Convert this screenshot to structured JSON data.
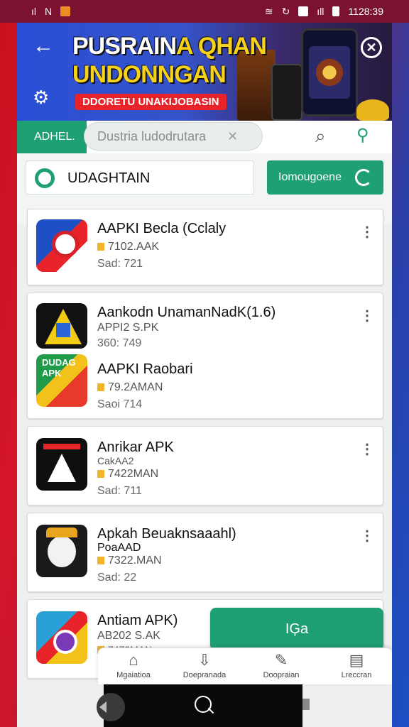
{
  "status": {
    "time": "1128:39"
  },
  "banner": {
    "title_line1_white": "PUSRAIN",
    "title_line1_yellow": "A QHAN",
    "title_line2": "UNDONNGAN",
    "tagline": "DDORETU UNAKIJOBASIN"
  },
  "search": {
    "label": "ADHEL.",
    "placeholder": "Dustria ludodrutara",
    "clear_label": "✕"
  },
  "category": {
    "label": "UDAGHTAIN"
  },
  "action_button": {
    "label": "Iomougoene"
  },
  "apps": [
    {
      "name": "AAPKI Becla (Cclaly",
      "size": "7102.AAK",
      "meta": "Sad: 721"
    },
    {
      "name": "Aankodn UnamanNadK(1.6)",
      "size": "APPI2 S.PK",
      "meta": "360: 749"
    },
    {
      "name": "AAPKI Raobari",
      "size": "79.2AMAN",
      "meta": "Saoi 714",
      "icon_text": "DUDAG APK"
    },
    {
      "name": "Anrikar APK",
      "size": "CakAA2",
      "size2": "7422MAN",
      "meta": "Sad: 711"
    },
    {
      "name": "Apkah Beuaknsaaahl)",
      "size": "PoaAAD",
      "size2": "7322.MAN",
      "meta": "Sad: 22"
    },
    {
      "name": "Antiam APK)",
      "size": "AB202 S.AK",
      "size2": "7472MAN"
    }
  ],
  "fab": {
    "label": "IĢa"
  },
  "bottom_nav": [
    {
      "label": "Mgaiatioa",
      "icon": "home-icon"
    },
    {
      "label": "Doepranada",
      "icon": "download-icon"
    },
    {
      "label": "Doopraian",
      "icon": "edit-icon"
    },
    {
      "label": "Lreccran",
      "icon": "notes-icon"
    }
  ]
}
